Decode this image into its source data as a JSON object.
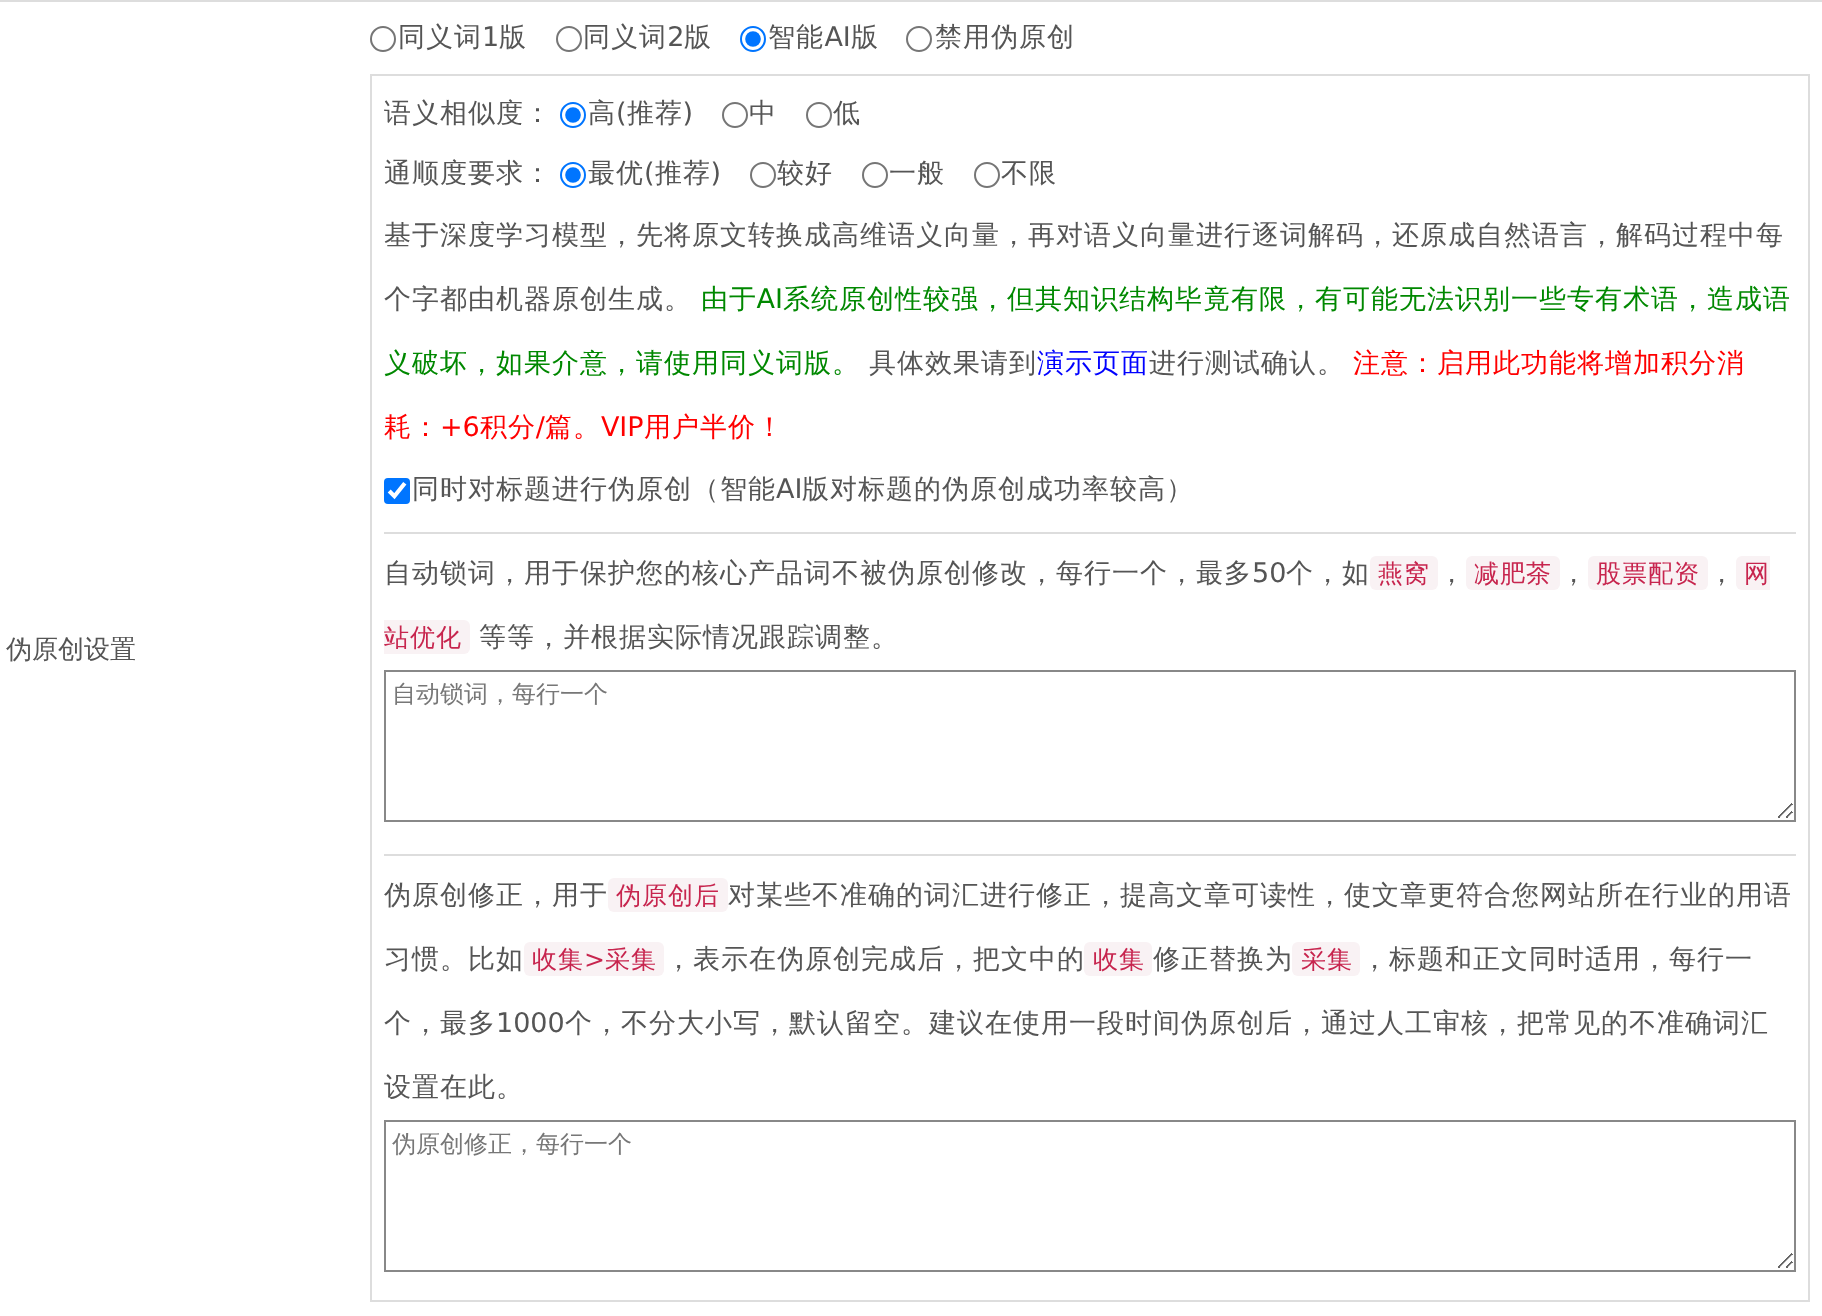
{
  "section_label": "伪原创设置",
  "modes": [
    {
      "label": "同义词1版",
      "selected": false
    },
    {
      "label": "同义词2版",
      "selected": false
    },
    {
      "label": "智能AI版",
      "selected": true
    },
    {
      "label": "禁用伪原创",
      "selected": false
    }
  ],
  "similarity": {
    "label": "语义相似度：",
    "options": [
      {
        "label": "高(推荐)",
        "selected": true
      },
      {
        "label": "中",
        "selected": false
      },
      {
        "label": "低",
        "selected": false
      }
    ]
  },
  "fluency": {
    "label": "通顺度要求：",
    "options": [
      {
        "label": "最优(推荐)",
        "selected": true
      },
      {
        "label": "较好",
        "selected": false
      },
      {
        "label": "一般",
        "selected": false
      },
      {
        "label": "不限",
        "selected": false
      }
    ]
  },
  "ai_description": [
    {
      "kind": "plain",
      "text": "基于深度学习模型，先将原文转换成高维语义向量，再对语义向量进行逐词解码，还原成自然语言，解码过程中每个字都由机器原创生成。 "
    },
    {
      "kind": "green",
      "text": "由于AI系统原创性较强，但其知识结构毕竟有限，有可能无法识别一些专有术语，造成语义破坏，如果介意，请使用同义词版。"
    },
    {
      "kind": "plain",
      "text": " 具体效果请到"
    },
    {
      "kind": "link",
      "text": "演示页面"
    },
    {
      "kind": "plain",
      "text": "进行测试确认。 "
    },
    {
      "kind": "red",
      "text": "注意：启用此功能将增加积分消耗：+6积分/篇。VIP用户半价！"
    }
  ],
  "title_option": {
    "label": "同时对标题进行伪原创（智能AI版对标题的伪原创成功率较高）",
    "checked": true
  },
  "lock_words": {
    "description": [
      {
        "kind": "plain",
        "text": "自动锁词，用于保护您的核心产品词不被伪原创修改，每行一个，最多50个，如"
      },
      {
        "kind": "code",
        "text": "燕窝"
      },
      {
        "kind": "plain",
        "text": "，"
      },
      {
        "kind": "code",
        "text": "减肥茶"
      },
      {
        "kind": "plain",
        "text": "，"
      },
      {
        "kind": "code",
        "text": "股票配资"
      },
      {
        "kind": "plain",
        "text": "，"
      },
      {
        "kind": "code",
        "text": "网站优化"
      },
      {
        "kind": "plain",
        "text": " 等等，并根据实际情况跟踪调整。"
      }
    ],
    "placeholder": "自动锁词，每行一个"
  },
  "corrections": {
    "description": [
      {
        "kind": "plain",
        "text": "伪原创修正，用于"
      },
      {
        "kind": "code",
        "text": "伪原创后"
      },
      {
        "kind": "plain",
        "text": "对某些不准确的词汇进行修正，提高文章可读性，使文章更符合您网站所在行业的用语习惯。比如"
      },
      {
        "kind": "code",
        "text": "收集>采集"
      },
      {
        "kind": "plain",
        "text": "，表示在伪原创完成后，把文中的"
      },
      {
        "kind": "code",
        "text": "收集"
      },
      {
        "kind": "plain",
        "text": "修正替换为"
      },
      {
        "kind": "code",
        "text": "采集"
      },
      {
        "kind": "plain",
        "text": "，标题和正文同时适用，每行一个，最多1000个，不分大小写，默认留空。建议在使用一段时间伪原创后，通过人工审核，把常见的不准确词汇设置在此。"
      }
    ],
    "placeholder": "伪原创修正，每行一个"
  }
}
